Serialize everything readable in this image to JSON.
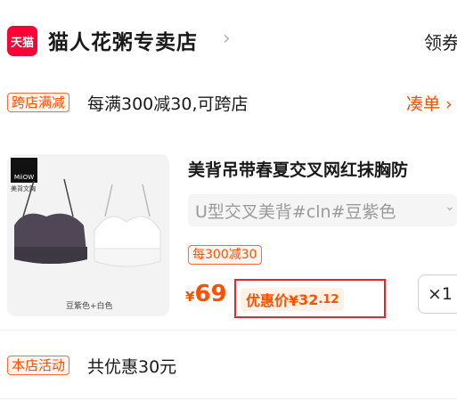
{
  "store": {
    "logo_text": "天猫",
    "name": "猫人花粥专卖店",
    "chevron": "›",
    "coupon_label": "领券"
  },
  "promo": {
    "tag": "跨店满减",
    "text": "每满300减30,可跨店",
    "link": "凑单 ›"
  },
  "product": {
    "brand_logo": "MiiOW",
    "brand_sub": "美背文胸",
    "image_caption": "豆紫色+白色",
    "title": "美背吊带春夏交叉网红抹胸防",
    "variant": "U型交叉美背#cln#豆紫色",
    "variant_chevron": "⌄",
    "discount_tag": "每300减30",
    "price_symbol": "¥",
    "price": "69",
    "discount_label": "优惠价¥",
    "discount_int": "32",
    "discount_dec": ".12",
    "quantity": "×1"
  },
  "activity": {
    "tag": "本店活动",
    "text": "共优惠30元"
  },
  "colors": {
    "accent": "#ff5000",
    "tmall_red": "#ff0036",
    "highlight_box": "#e8262a"
  }
}
